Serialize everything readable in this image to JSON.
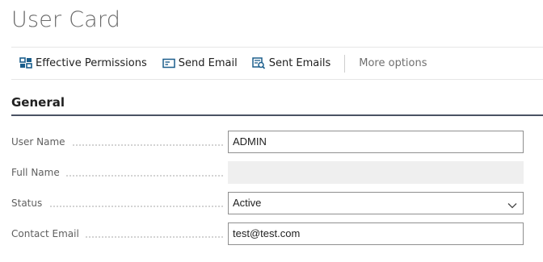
{
  "page": {
    "title": "User Card"
  },
  "actions": {
    "effective_permissions": "Effective Permissions",
    "send_email": "Send Email",
    "sent_emails": "Sent Emails",
    "more_options": "More options"
  },
  "icons": {
    "effective_permissions": "permissions-icon",
    "send_email": "email-icon",
    "sent_emails": "sent-emails-icon",
    "status_dropdown": "chevron-down-icon"
  },
  "section": {
    "title": "General"
  },
  "fields": {
    "user_name": {
      "label": "User Name",
      "value": "ADMIN"
    },
    "full_name": {
      "label": "Full Name",
      "value": ""
    },
    "status": {
      "label": "Status",
      "value": "Active"
    },
    "contact_email": {
      "label": "Contact Email",
      "value": "test@test.com"
    }
  },
  "colors": {
    "icon_blue": "#1b5e8c",
    "section_rule": "#4a5263",
    "readonly_bg": "#efefef"
  }
}
